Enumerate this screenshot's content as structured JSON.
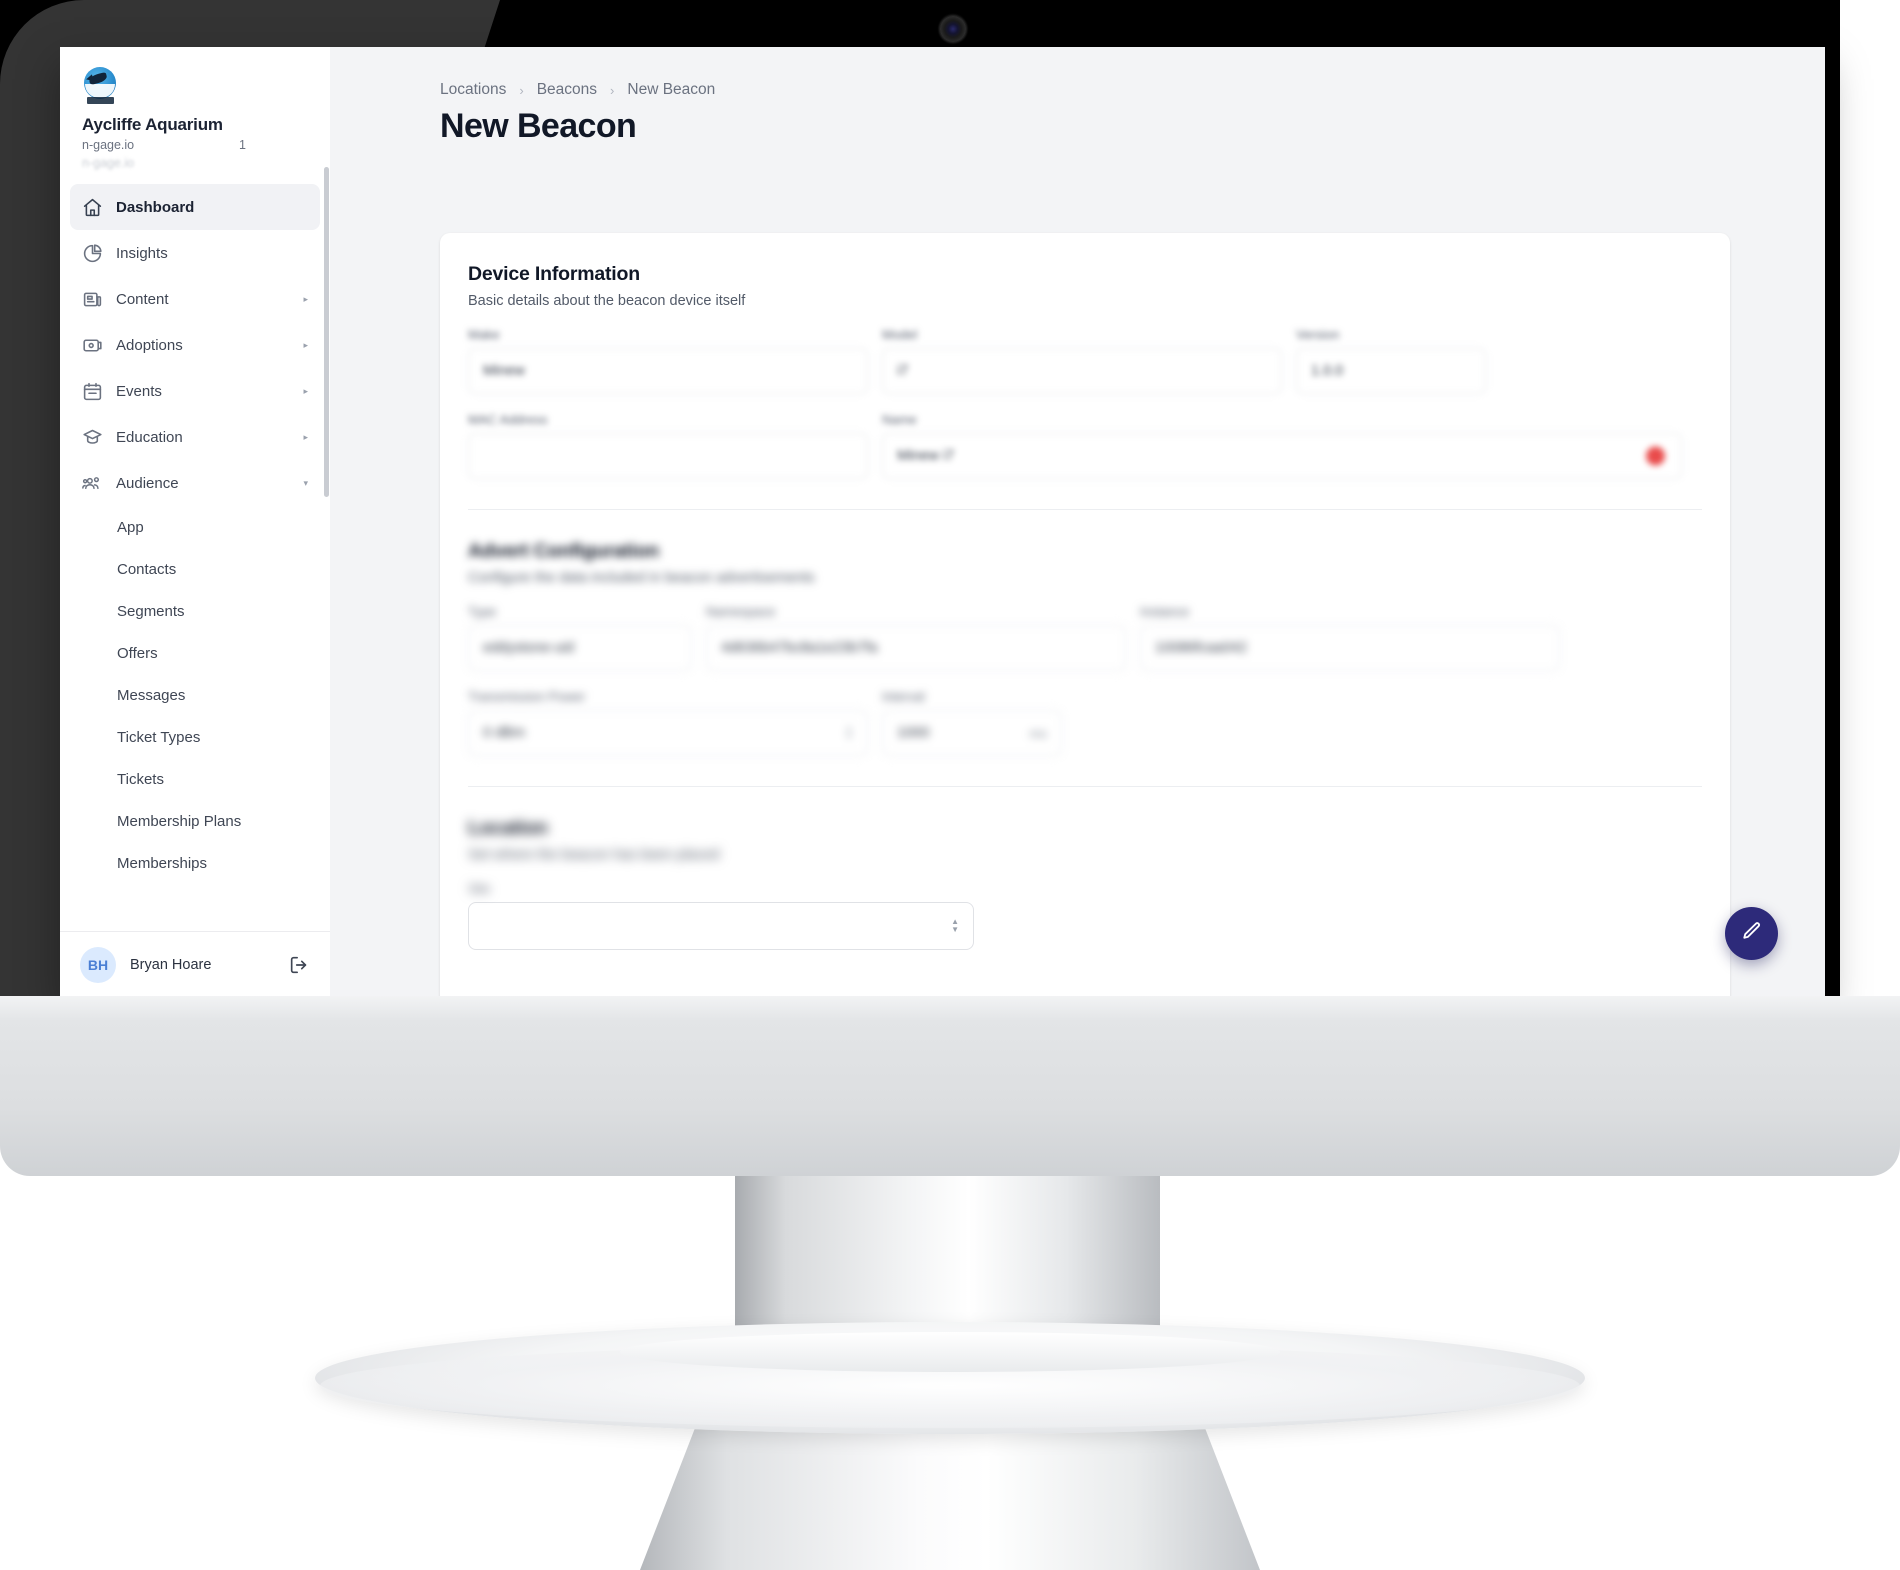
{
  "device": {
    "webcam_label": "webcam"
  },
  "sidebar": {
    "brand": {
      "name": "Aycliffe Aquarium",
      "domain": "n-gage.io",
      "badge": "1",
      "ghost": "n-gage.io"
    },
    "items": [
      {
        "label": "Dashboard",
        "icon": "home-icon",
        "active": true,
        "expandable": false
      },
      {
        "label": "Insights",
        "icon": "pie-chart-icon",
        "active": false,
        "expandable": false
      },
      {
        "label": "Content",
        "icon": "news-icon",
        "active": false,
        "expandable": true
      },
      {
        "label": "Adoptions",
        "icon": "card-icon",
        "active": false,
        "expandable": true
      },
      {
        "label": "Events",
        "icon": "calendar-icon",
        "active": false,
        "expandable": true
      },
      {
        "label": "Education",
        "icon": "graduation-icon",
        "active": false,
        "expandable": true
      },
      {
        "label": "Audience",
        "icon": "people-icon",
        "active": false,
        "expandable": true,
        "expanded": true
      }
    ],
    "sub_items": [
      {
        "label": "App"
      },
      {
        "label": "Contacts"
      },
      {
        "label": "Segments"
      },
      {
        "label": "Offers"
      },
      {
        "label": "Messages"
      },
      {
        "label": "Ticket Types"
      },
      {
        "label": "Tickets"
      },
      {
        "label": "Membership Plans"
      },
      {
        "label": "Memberships"
      }
    ],
    "caret_collapsed": "▸",
    "caret_expanded": "▾",
    "user": {
      "initials": "BH",
      "name": "Bryan Hoare",
      "logout_icon": "logout-icon"
    }
  },
  "main": {
    "breadcrumb": [
      {
        "label": "Locations"
      },
      {
        "label": "Beacons"
      },
      {
        "label": "New Beacon"
      }
    ],
    "breadcrumb_separator": "›",
    "title": "New Beacon",
    "sections": [
      {
        "title": "Device Information",
        "subtitle": "Basic details about the beacon device itself"
      },
      {
        "title": "Advert Configuration",
        "subtitle": "Configure the data included in beacon advertisements"
      },
      {
        "title": "Location",
        "subtitle": "Set where the beacon has been placed"
      }
    ],
    "device_fields": [
      {
        "label": "Make",
        "value": "Minew"
      },
      {
        "label": "Model",
        "value": "i7"
      },
      {
        "label": "Version",
        "value": "1.0.0"
      },
      {
        "label": "MAC Address",
        "value": ""
      },
      {
        "label": "Name",
        "value": "Minew i7",
        "status_color": "#e94b4b"
      }
    ],
    "advert_fields": [
      {
        "label": "Type",
        "value": "eddystone-uid"
      },
      {
        "label": "Namespace",
        "value": "4d636b47bc8a1e23b7fa"
      },
      {
        "label": "Instance",
        "value": "10086fcaa042"
      },
      {
        "label": "Transmission Power",
        "value": "0 dBm"
      },
      {
        "label": "Interval",
        "value": "1000",
        "suffix": "ms"
      }
    ],
    "location_fields": [
      {
        "label": "Site",
        "value": ""
      }
    ],
    "fab": {
      "icon": "pencil-icon",
      "color": "#2d2a7a"
    }
  }
}
